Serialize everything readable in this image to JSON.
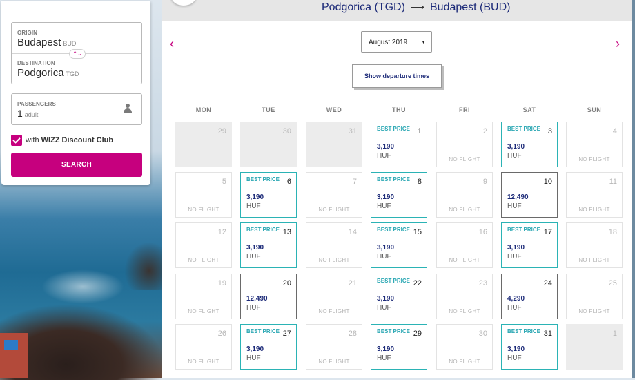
{
  "search": {
    "origin_label": "ORIGIN",
    "origin_city": "Budapest",
    "origin_code": "BUD",
    "destination_label": "DESTINATION",
    "destination_city": "Podgorica",
    "destination_code": "TGD",
    "passengers_label": "PASSENGERS",
    "passengers_count": "1",
    "passengers_unit": "adult",
    "club_prefix": "with",
    "club_name": "WIZZ Discount Club",
    "club_checked": true,
    "search_button": "SEARCH",
    "swap_icon": "swap-arrows-icon"
  },
  "header": {
    "from": "Podgorica (TGD)",
    "arrow": "⟶",
    "to": "Budapest (BUD)"
  },
  "calendar": {
    "month": "August 2019",
    "show_times_button": "Show departure times",
    "weekdays": [
      "MON",
      "TUE",
      "WED",
      "THU",
      "FRI",
      "SAT",
      "SUN"
    ],
    "best_price_label": "BEST PRICE",
    "no_flight_label": "NO FLIGHT",
    "accent_color": "#c6007e",
    "best_color": "#2bb3b5",
    "days": [
      {
        "d": "29",
        "s": "past"
      },
      {
        "d": "30",
        "s": "past"
      },
      {
        "d": "31",
        "s": "past"
      },
      {
        "d": "1",
        "s": "best",
        "p": "3,190",
        "c": "HUF"
      },
      {
        "d": "2",
        "s": "none"
      },
      {
        "d": "3",
        "s": "best",
        "p": "3,190",
        "c": "HUF"
      },
      {
        "d": "4",
        "s": "none"
      },
      {
        "d": "5",
        "s": "none"
      },
      {
        "d": "6",
        "s": "best",
        "p": "3,190",
        "c": "HUF"
      },
      {
        "d": "7",
        "s": "none"
      },
      {
        "d": "8",
        "s": "best",
        "p": "3,190",
        "c": "HUF"
      },
      {
        "d": "9",
        "s": "none"
      },
      {
        "d": "10",
        "s": "price",
        "p": "12,490",
        "c": "HUF"
      },
      {
        "d": "11",
        "s": "none"
      },
      {
        "d": "12",
        "s": "none"
      },
      {
        "d": "13",
        "s": "best",
        "p": "3,190",
        "c": "HUF"
      },
      {
        "d": "14",
        "s": "none"
      },
      {
        "d": "15",
        "s": "best",
        "p": "3,190",
        "c": "HUF"
      },
      {
        "d": "16",
        "s": "none"
      },
      {
        "d": "17",
        "s": "best",
        "p": "3,190",
        "c": "HUF"
      },
      {
        "d": "18",
        "s": "none"
      },
      {
        "d": "19",
        "s": "none"
      },
      {
        "d": "20",
        "s": "price",
        "p": "12,490",
        "c": "HUF"
      },
      {
        "d": "21",
        "s": "none"
      },
      {
        "d": "22",
        "s": "best",
        "p": "3,190",
        "c": "HUF"
      },
      {
        "d": "23",
        "s": "none"
      },
      {
        "d": "24",
        "s": "price",
        "p": "4,290",
        "c": "HUF"
      },
      {
        "d": "25",
        "s": "none"
      },
      {
        "d": "26",
        "s": "none"
      },
      {
        "d": "27",
        "s": "best",
        "p": "3,190",
        "c": "HUF"
      },
      {
        "d": "28",
        "s": "none"
      },
      {
        "d": "29",
        "s": "best",
        "p": "3,190",
        "c": "HUF"
      },
      {
        "d": "30",
        "s": "none"
      },
      {
        "d": "31",
        "s": "best",
        "p": "3,190",
        "c": "HUF"
      },
      {
        "d": "1",
        "s": "next"
      }
    ]
  }
}
